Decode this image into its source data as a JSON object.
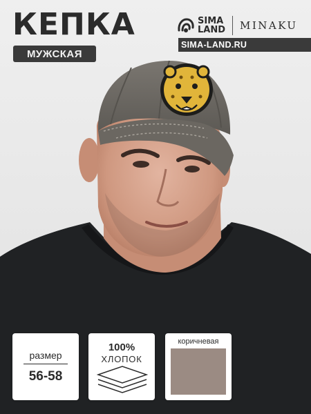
{
  "product": {
    "title": "КЕПКА",
    "subtitle": "МУЖСКАЯ"
  },
  "brand": {
    "logo_line1": "SIMA",
    "logo_line2": "LAND",
    "partner": "MINAKU",
    "site": "SIMA-LAND.RU",
    "logo_icon": "sima-land-logo-icon"
  },
  "photo": {
    "icon": "man-in-cap-photo"
  },
  "tiles": {
    "size": {
      "label": "размер",
      "value": "56-58"
    },
    "material": {
      "value": "100%",
      "label": "ХЛОПОК",
      "icon": "fabric-layers-icon"
    },
    "color": {
      "label": "коричневая",
      "swatch": "#9b8b83"
    }
  },
  "colors": {
    "dark": "#3a3a3a",
    "cap": "#6e6a64",
    "swatch": "#9b8b83"
  }
}
